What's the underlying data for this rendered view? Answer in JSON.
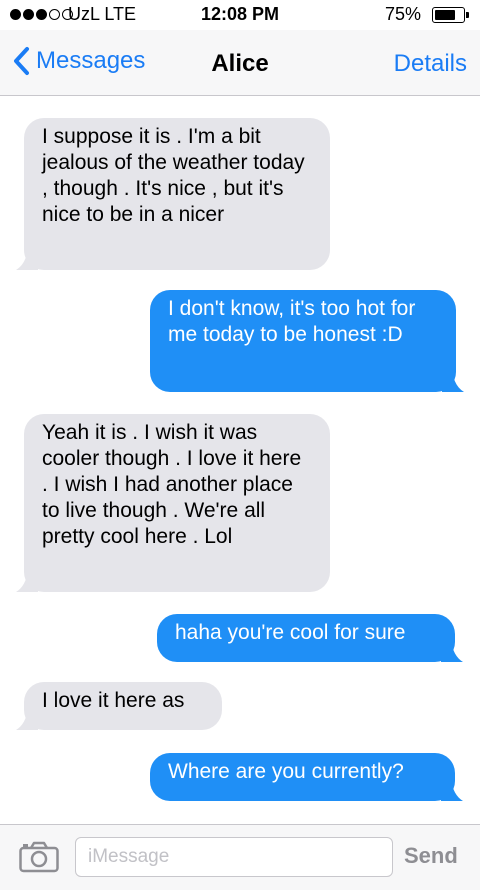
{
  "status_bar": {
    "signal_dots_filled": 3,
    "signal_dots_total": 5,
    "carrier": "UzL  LTE",
    "time": "12:08 PM",
    "battery_percent": "75%",
    "battery_level": 0.75
  },
  "nav": {
    "back_label": "Messages",
    "title": "Alice",
    "details_label": "Details",
    "accent_color": "#1a7cf5"
  },
  "messages": [
    {
      "direction": "in",
      "text": "I suppose it is . I'm a bit jealous of the weather today , though . It's nice , but it's nice to be in a nicer"
    },
    {
      "direction": "out",
      "text": "I don't know, it's too hot for me today to be honest :D"
    },
    {
      "direction": "in",
      "text": "Yeah it is . I wish it was cooler though . I love it here . I wish I had another place to live though . We're all pretty cool here . Lol"
    },
    {
      "direction": "out",
      "text": "haha you're cool for sure"
    },
    {
      "direction": "in",
      "text": "I love it here as"
    },
    {
      "direction": "out",
      "text": "Where are you currently?"
    }
  ],
  "input_bar": {
    "camera_icon": "camera-icon",
    "placeholder": "iMessage",
    "value": "",
    "send_label": "Send"
  },
  "colors": {
    "incoming_bubble": "#e5e5ea",
    "outgoing_bubble": "#1f8ff6"
  }
}
